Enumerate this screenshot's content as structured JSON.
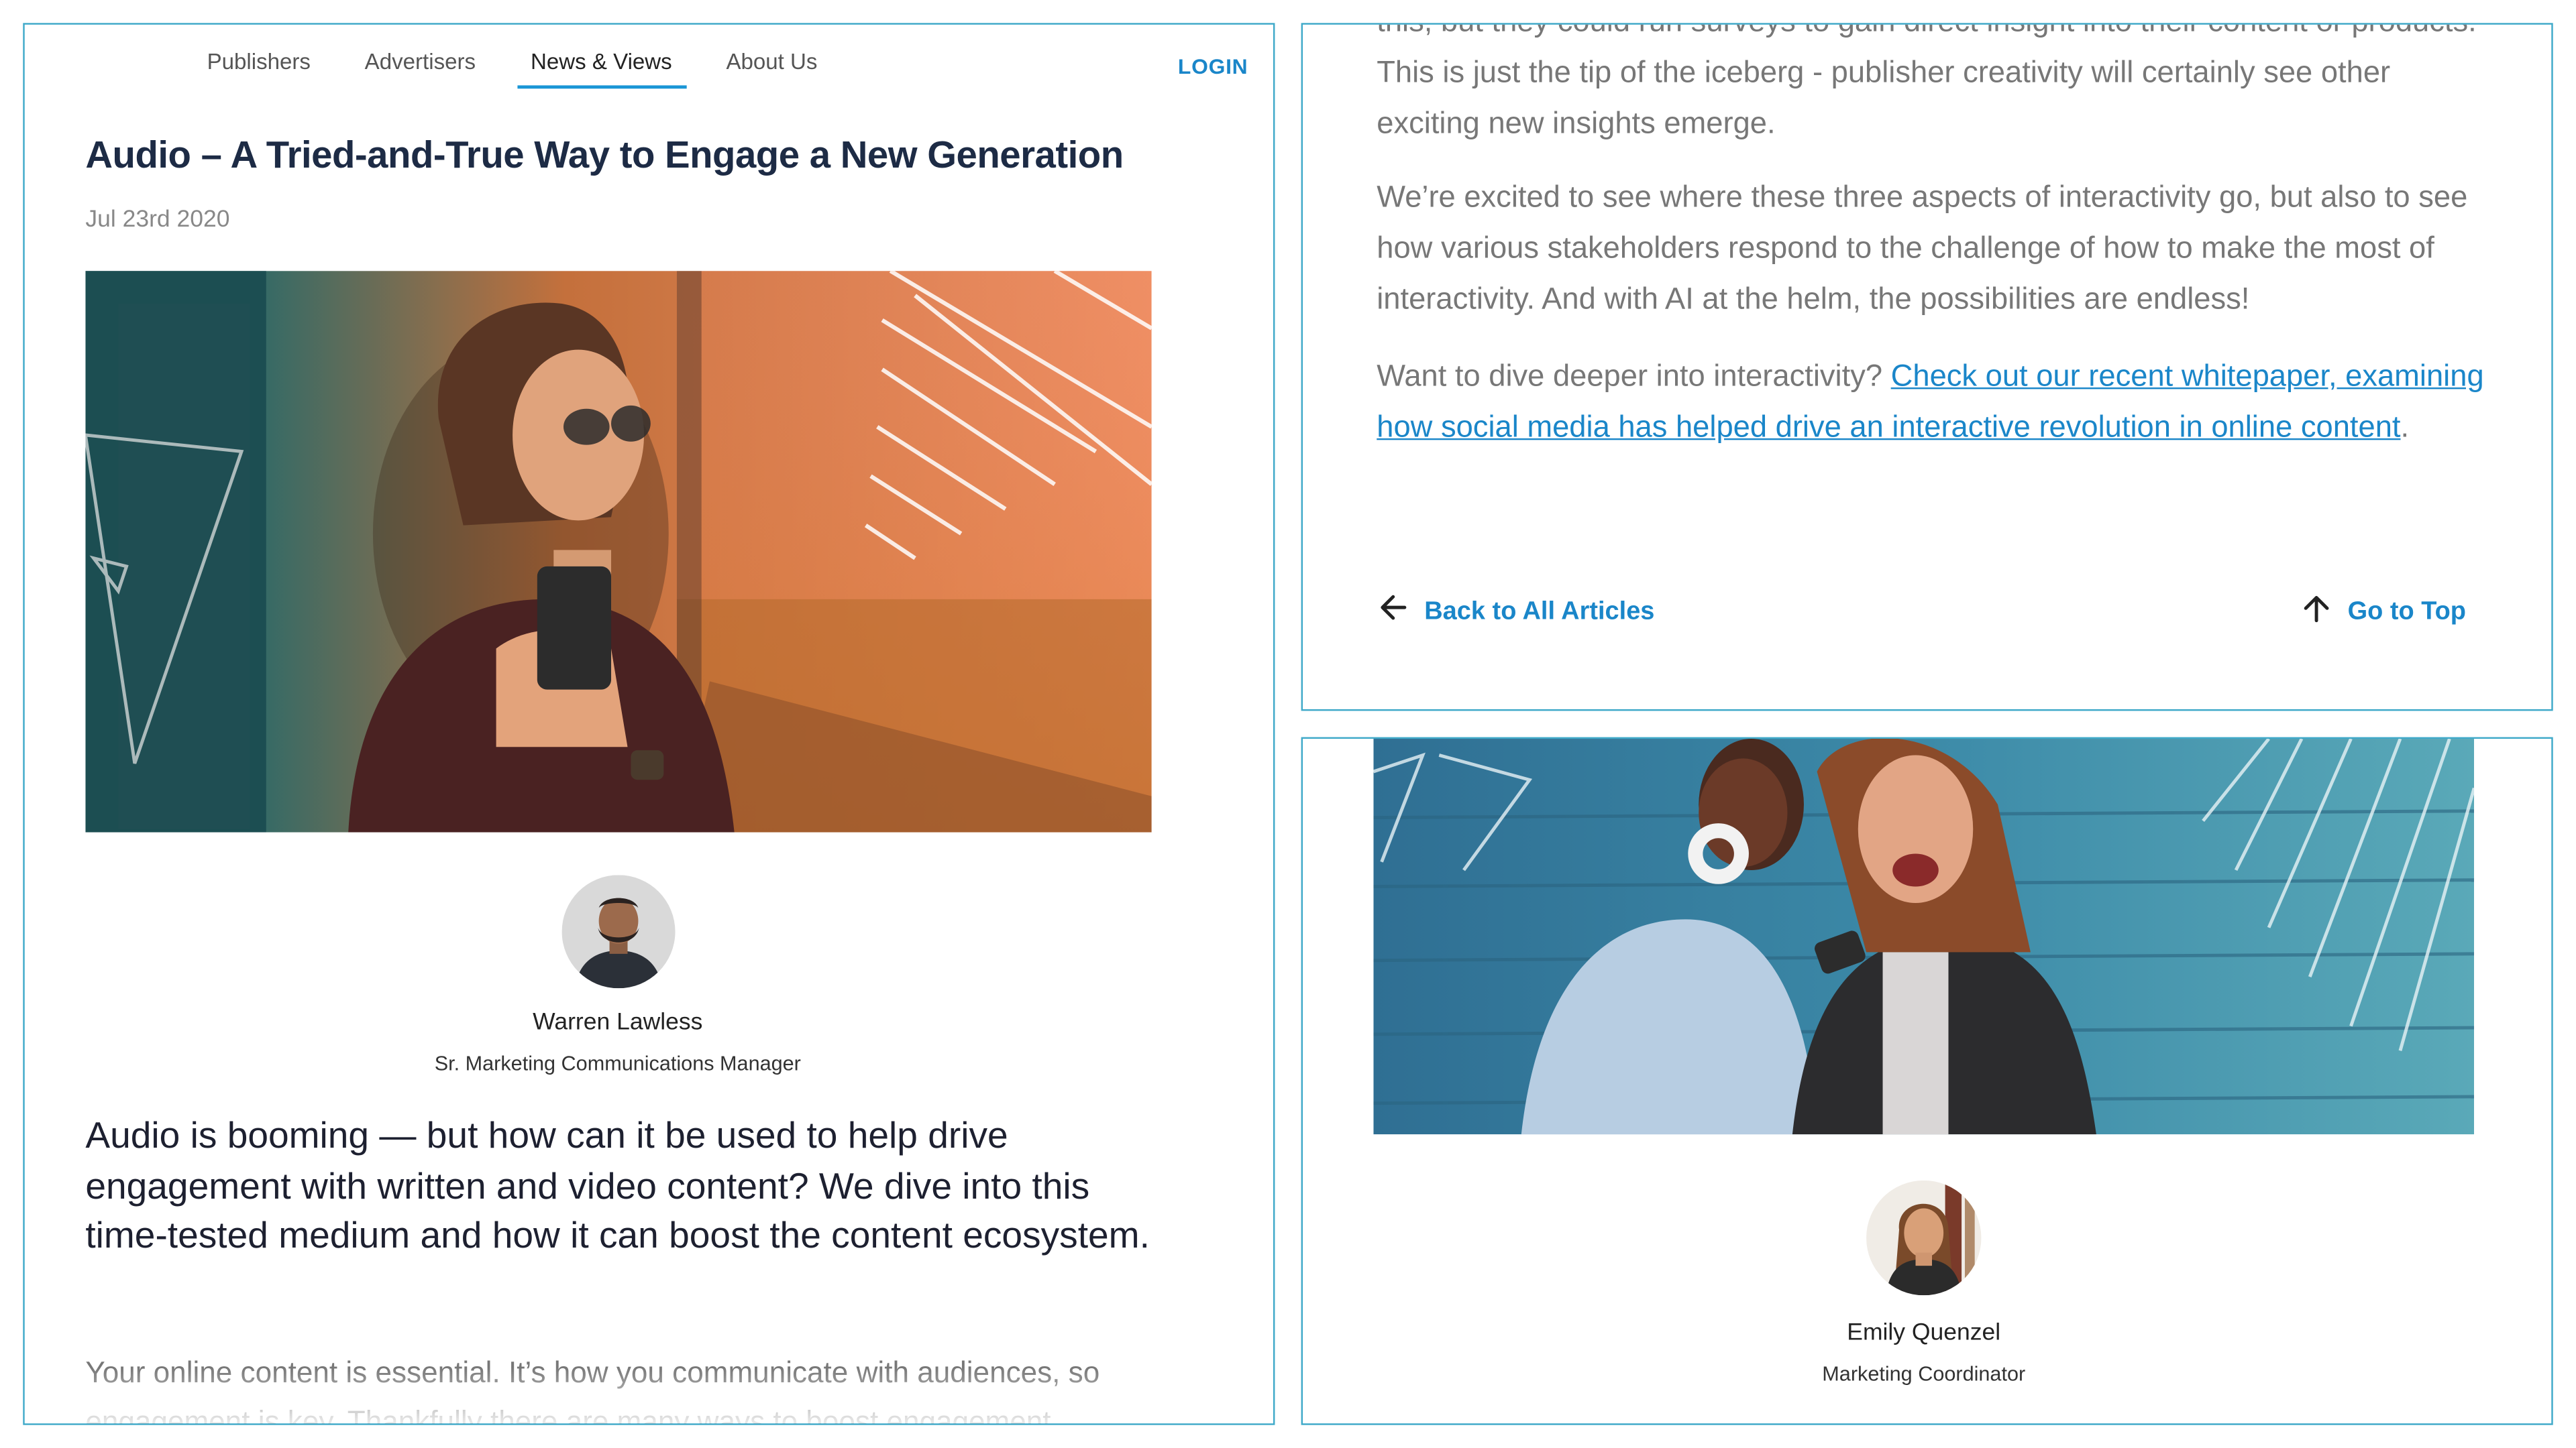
{
  "nav": {
    "items": [
      {
        "label": "Publishers"
      },
      {
        "label": "Advertisers"
      },
      {
        "label": "News & Views"
      },
      {
        "label": "About Us"
      }
    ],
    "active_index": 2,
    "login_label": "LOGIN"
  },
  "article": {
    "title": "Audio – A Tried-and-True Way to Engage a New Generation",
    "date": "Jul 23rd 2020",
    "author": {
      "name": "Warren Lawless",
      "role": "Sr. Marketing Communications Manager"
    },
    "lede": "Audio is booming — but how can it be used to help drive engagement with written and video content? We dive into this time-tested medium and how it can boost the content ecosystem.",
    "body_start": "Your online content is essential. It’s how you communicate with audiences, so engagement is key. Thankfully there are many ways to boost engagement"
  },
  "article_end": {
    "para1": "this, but they could run surveys to gain direct insight into their content or products. This is just the tip of the iceberg - publisher creativity will certainly see other exciting new insights emerge.",
    "para2": "We’re excited to see where these three aspects of interactivity go, but also to see how various stakeholders respond to the challenge of how to make the most of interactivity. And with AI at the helm, the possibilities are endless!",
    "para3_lead": "Want to dive deeper into interactivity? ",
    "para3_link": "Check out our recent whitepaper, examining how social media has helped drive an interactive revolution in online content",
    "para3_end": ".",
    "back_label": "Back to All Articles",
    "top_label": "Go to Top"
  },
  "next_article": {
    "author": {
      "name": "Emily Quenzel",
      "role": "Marketing Coordinator"
    }
  },
  "icons": {
    "back": "arrow-left-icon",
    "top": "arrow-up-icon"
  },
  "colors": {
    "accent": "#1a86c9",
    "border": "#3fa9c9",
    "title": "#1d2b45"
  }
}
